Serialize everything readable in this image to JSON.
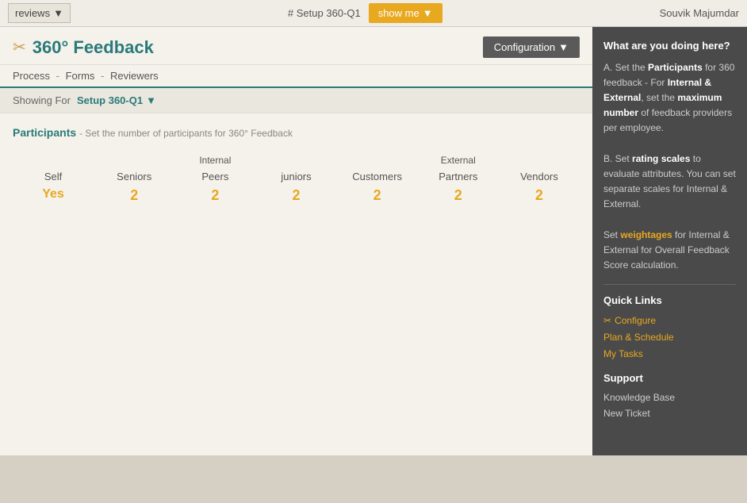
{
  "topbar": {
    "reviews_label": "reviews",
    "dropdown_arrow": "▼",
    "setup_label": "# Setup 360-Q1",
    "show_me_label": "show me",
    "show_me_arrow": "▼",
    "user_name": "Souvik Majumdar"
  },
  "page": {
    "icon": "✂",
    "title": "360° Feedback",
    "config_label": "Configuration",
    "config_arrow": "▼"
  },
  "breadcrumb": {
    "process": "Process",
    "sep1": "-",
    "forms": "Forms",
    "sep2": "-",
    "reviewers": "Reviewers"
  },
  "showing_for": {
    "label": "Showing For",
    "value": "Setup 360-Q1",
    "arrow": "▼"
  },
  "participants": {
    "title": "Participants",
    "subtitle": "- Set the number of participants for 360° Feedback",
    "columns": [
      {
        "group": "",
        "label": "Self",
        "value": "Yes"
      },
      {
        "group": "",
        "label": "Seniors",
        "value": "2"
      },
      {
        "group": "Internal",
        "label": "Peers",
        "value": "2"
      },
      {
        "group": "",
        "label": "juniors",
        "value": "2"
      },
      {
        "group": "",
        "label": "Customers",
        "value": "2"
      },
      {
        "group": "External",
        "label": "Partners",
        "value": "2"
      },
      {
        "group": "",
        "label": "Vendors",
        "value": "2"
      }
    ]
  },
  "sidebar": {
    "what_title": "What are you doing here?",
    "body_a": "A. Set the ",
    "body_a_bold": "Participants",
    "body_a2": " for 360 feedback - For ",
    "body_a3_bold": "Internal & External",
    "body_a3": ", set the ",
    "body_a4_bold": "maximum number",
    "body_a4": " of feedback providers per employee.",
    "body_b": "B. Set ",
    "body_b_bold": "rating scales",
    "body_b2": " to evaluate attributes. You can set separate scales for Internal & External.",
    "body_c_pre": "Set ",
    "body_c_bold": "weightages",
    "body_c_post": " for Internal & External for Overall Feedback Score calculation.",
    "quick_links_title": "Quick Links",
    "quick_links": [
      {
        "icon": "✂",
        "label": "Configure"
      },
      {
        "icon": "",
        "label": "Plan & Schedule"
      },
      {
        "icon": "",
        "label": "My Tasks"
      }
    ],
    "support_title": "Support",
    "support_links": [
      {
        "label": "Knowledge Base"
      },
      {
        "label": "New Ticket"
      }
    ]
  }
}
